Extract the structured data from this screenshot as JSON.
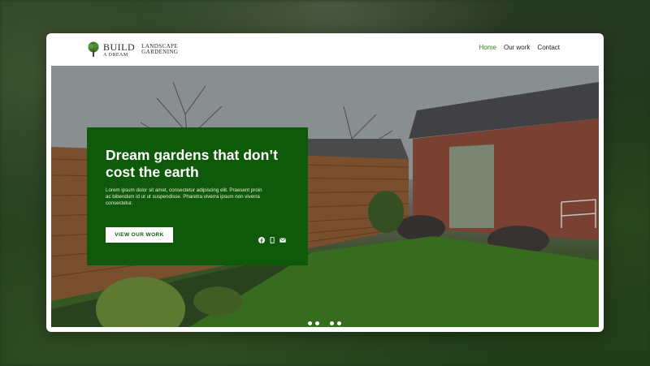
{
  "brand": {
    "name_main": "BUILD",
    "name_sub": "A DREAM",
    "tagline_line1": "LANDSCAPE",
    "tagline_line2": "GARDENING"
  },
  "nav": {
    "items": [
      {
        "label": "Home",
        "active": true
      },
      {
        "label": "Our work",
        "active": false
      },
      {
        "label": "Contact",
        "active": false
      }
    ]
  },
  "hero": {
    "heading": "Dream gardens that don’t cost the earth",
    "body": "Lorem ipsum dolor sit amet, consectetur adipiscing elit. Praesent proin ac bibendum id ut ut suspendisse. Pharetra viverra ipsum non viverra consectetur.",
    "cta_label": "VIEW OUR WORK",
    "social_icons": [
      "facebook-icon",
      "phone-icon",
      "mail-icon"
    ]
  },
  "carousel": {
    "count": 5,
    "active_index": 2
  },
  "colors": {
    "brand_green": "#0e5a0a",
    "active_nav": "#2f7d1f",
    "active_dot": "#1f7a14"
  }
}
